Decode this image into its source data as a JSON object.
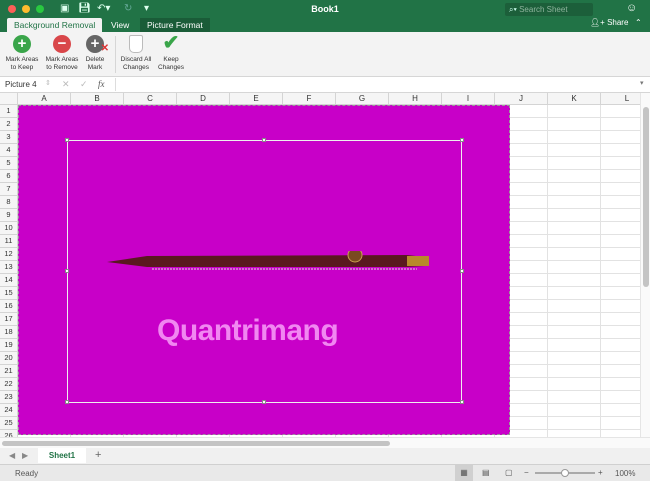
{
  "window": {
    "title": "Book1",
    "search_placeholder": "Search Sheet",
    "share_label": "Share"
  },
  "quick_access": [
    "sidebar-icon",
    "save-icon",
    "undo-icon",
    "redo-icon",
    "customize-icon"
  ],
  "tabs": [
    {
      "label": "Background Removal",
      "active": true
    },
    {
      "label": "View"
    },
    {
      "label": "Picture Format"
    }
  ],
  "ribbon": {
    "buttons": [
      {
        "line1": "Mark Areas",
        "line2": "to Keep",
        "color": "#3aa54a"
      },
      {
        "line1": "Mark Areas",
        "line2": "to Remove",
        "color": "#d9474a"
      },
      {
        "line1": "Delete",
        "line2": "Mark",
        "color": "#666666"
      },
      {
        "line1": "Discard All",
        "line2": "Changes"
      },
      {
        "line1": "Keep",
        "line2": "Changes",
        "color": "#3aa54a"
      }
    ]
  },
  "formula_bar": {
    "name_box": "Picture 4",
    "fx": "fx",
    "value": ""
  },
  "columns": [
    "A",
    "B",
    "C",
    "D",
    "E",
    "F",
    "G",
    "H",
    "I",
    "J",
    "K",
    "L"
  ],
  "rows": [
    "1",
    "2",
    "3",
    "4",
    "5",
    "6",
    "7",
    "8",
    "9",
    "10",
    "11",
    "12",
    "13",
    "14",
    "15",
    "16",
    "17",
    "18",
    "19",
    "20",
    "21",
    "22",
    "23",
    "24",
    "25",
    "26"
  ],
  "picture": {
    "background": "#c800c8",
    "watermark": "Quantrimang"
  },
  "sheets": [
    {
      "label": "Sheet1",
      "active": true
    }
  ],
  "status": {
    "text": "Ready",
    "zoom": "100%",
    "zoom_fraction": 0.5
  }
}
